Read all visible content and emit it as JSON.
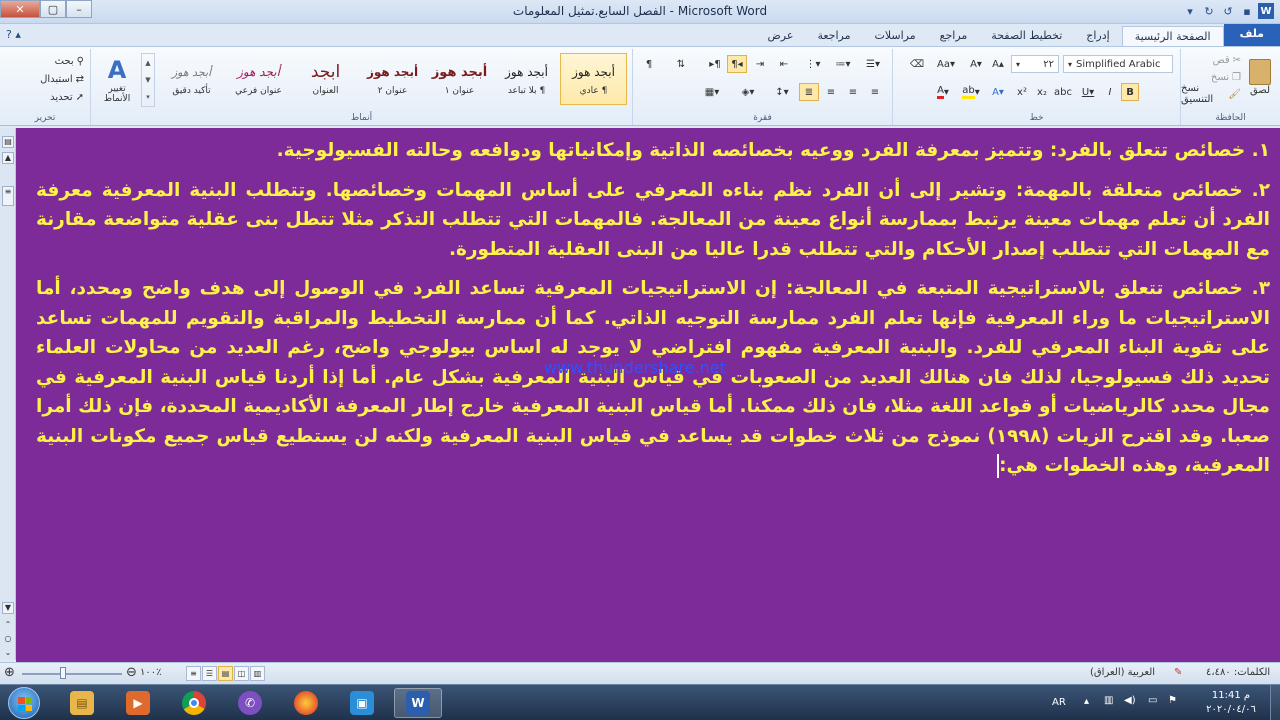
{
  "window": {
    "title": "الفصل السابع.تمثيل المعلومات - Microsoft Word",
    "close": "✕",
    "maximize": "▢",
    "minimize": "–"
  },
  "tabs": [
    {
      "label": "ملف"
    },
    {
      "label": "الصفحة الرئيسية"
    },
    {
      "label": "إدراج"
    },
    {
      "label": "تخطيط الصفحة"
    },
    {
      "label": "مراجع"
    },
    {
      "label": "مراسلات"
    },
    {
      "label": "مراجعة"
    },
    {
      "label": "عرض"
    }
  ],
  "ribbon": {
    "clipboard": {
      "label": "الحافظة",
      "paste": "لصق",
      "cut": "قص",
      "copy": "نسخ",
      "format_painter": "نسخ التنسيق"
    },
    "font": {
      "label": "خط",
      "font_name": "Simplified Arabic",
      "font_size": "٢٢"
    },
    "paragraph": {
      "label": "فقرة"
    },
    "styles": {
      "label": "أنماط",
      "change_styles": "تغيير الأنماط",
      "items": [
        {
          "preview": "أبجد هوز",
          "name": "¶ عادي",
          "color": "#222222"
        },
        {
          "preview": "أبجد هوز",
          "name": "¶ بلا تباعد",
          "color": "#222222"
        },
        {
          "preview": "أبجد هوز",
          "name": "عنوان ١",
          "color": "#7b1b1b"
        },
        {
          "preview": "أبجد هوز",
          "name": "عنوان ٢",
          "color": "#7b1b1b"
        },
        {
          "preview": "ابجد",
          "name": "العنوان",
          "color": "#7b1b1b"
        },
        {
          "preview": "أبجد هوز",
          "name": "عنوان فرعي",
          "color": "#a0205a"
        },
        {
          "preview": "أبجد هوز",
          "name": "تأكيد دقيق",
          "color": "#777777"
        }
      ]
    },
    "editing": {
      "label": "تحرير",
      "find": "بحث",
      "replace": "استبدال",
      "select": "تحديد"
    }
  },
  "document": {
    "paragraphs": [
      "١. خصائص تتعلق بالفرد: وتتميز بمعرفة الفرد ووعيه بخصائصه الذاتية وإمكانياتها ودوافعه وحالته الفسيولوجية.",
      "٢. خصائص متعلقة بالمهمة: وتشير إلى أن الفرد نظم بناءه المعرفي على أساس المهمات وخصائصها. وتتطلب البنية المعرفية معرفة الفرد أن تعلم مهمات معينة يرتبط بممارسة أنواع معينة من المعالجة. فالمهمات التي تتطلب التذكر مثلا تتطل بنى عقلية متواضعة مقارنة مع المهمات التي تتطلب إصدار الأحكام والتي تتطلب قدرا عاليا من البنى العقلية المتطورة.",
      "٣. خصائص تتعلق بالاستراتيجية المتبعة في المعالجة: إن الاستراتيجيات المعرفية تساعد الفرد في الوصول إلى هدف واضح ومحدد، أما الاستراتيجيات ما وراء المعرفية فإنها تعلم الفرد ممارسة التوجيه الذاتي. كما أن ممارسة التخطيط والمراقبة والتقويم للمهمات تساعد على تقوية البناء المعرفي للفرد. والبنية المعرفية مفهوم افتراضي لا يوجد له اساس بيولوجي واضح، رغم العديد من محاولات العلماء تحديد ذلك فسيولوجيا، لذلك فان هنالك العديد من الصعوبات في قياس البنية المعرفية بشكل عام. أما إذا أردنا قياس البنية المعرفية في مجال محدد كالرياضيات أو قواعد اللغة مثلا، فان ذلك ممكنا. أما قياس البنية المعرفية خارج إطار المعرفة الأكاديمية المحددة، فإن ذلك أمرا صعبا. وقد اقترح الزيات (١٩٩٨) نموذج من ثلاث خطوات قد يساعد في قياس البنية المعرفية ولكنه لن يستطيع قياس جميع مكونات البنية المعرفية، وهذه الخطوات هي:"
    ],
    "watermark": "www.thundershare.net",
    "background": "#7e2b9a",
    "text_color": "#fcf24a"
  },
  "statusbar": {
    "word_count": "الكلمات: ٤،٤٨٠",
    "language": "العربية (العراق)",
    "zoom": "١٠٠٪"
  },
  "taskbar": {
    "apps": [
      {
        "name": "file-explorer-icon",
        "color": "#e8b64a",
        "glyph": "▤"
      },
      {
        "name": "media-player-icon",
        "color": "#e06a2b",
        "glyph": "▶"
      },
      {
        "name": "chrome-icon",
        "color": "#2f9f45",
        "glyph": "●"
      },
      {
        "name": "viber-icon",
        "color": "#7d4fc1",
        "glyph": "✆"
      },
      {
        "name": "firefox-icon",
        "color": "#e5582b",
        "glyph": "◉"
      },
      {
        "name": "network-app-icon",
        "color": "#2a8fd6",
        "glyph": "▣"
      },
      {
        "name": "word-icon",
        "color": "#2b5fad",
        "glyph": "W"
      }
    ],
    "language": "AR",
    "time": "11:41 م",
    "date": "٢٠٢٠/٠٤/٠٦"
  }
}
